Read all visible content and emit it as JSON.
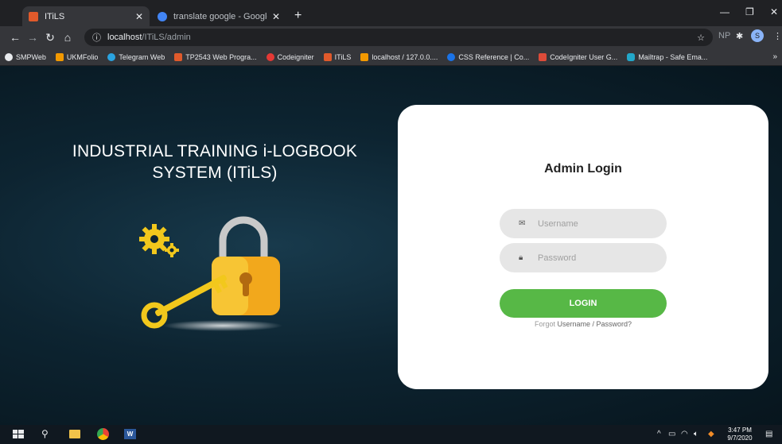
{
  "browser": {
    "tabs": [
      {
        "title": "ITiLS",
        "active": true,
        "favicon_color": "#e05a2b"
      },
      {
        "title": "translate google - Google Search",
        "active": false,
        "favicon_color": "#4285f4"
      }
    ],
    "url_host": "localhost",
    "url_path": "/ITiLS/admin",
    "profile_initial": "S",
    "extension_label": "NP",
    "bookmarks": [
      {
        "label": "SMPWeb",
        "color": "#e8eaed"
      },
      {
        "label": "UKMFolio",
        "color": "#f29900"
      },
      {
        "label": "Telegram Web",
        "color": "#2aa3e0"
      },
      {
        "label": "TP2543 Web Progra...",
        "color": "#e05a2b"
      },
      {
        "label": "Codeigniter",
        "color": "#e53935"
      },
      {
        "label": "ITiLS",
        "color": "#e05a2b"
      },
      {
        "label": "localhost / 127.0.0....",
        "color": "#f29900"
      },
      {
        "label": "CSS Reference | Co...",
        "color": "#1a73e8"
      },
      {
        "label": "CodeIgniter User G...",
        "color": "#dd4b39"
      },
      {
        "label": "Mailtrap - Safe Ema...",
        "color": "#22a7c9"
      }
    ]
  },
  "page": {
    "system_title_line1": "INDUSTRIAL TRAINING i-LOGBOOK",
    "system_title_line2": "SYSTEM (ITiLS)",
    "login": {
      "title": "Admin Login",
      "username_placeholder": "Username",
      "password_placeholder": "Password",
      "button_label": "LOGIN",
      "forgot_prefix": "Forgot ",
      "forgot_link": "Username / Password?"
    },
    "accent_color": "#57b846"
  },
  "taskbar": {
    "time": "3:47 PM",
    "date": "9/7/2020"
  }
}
